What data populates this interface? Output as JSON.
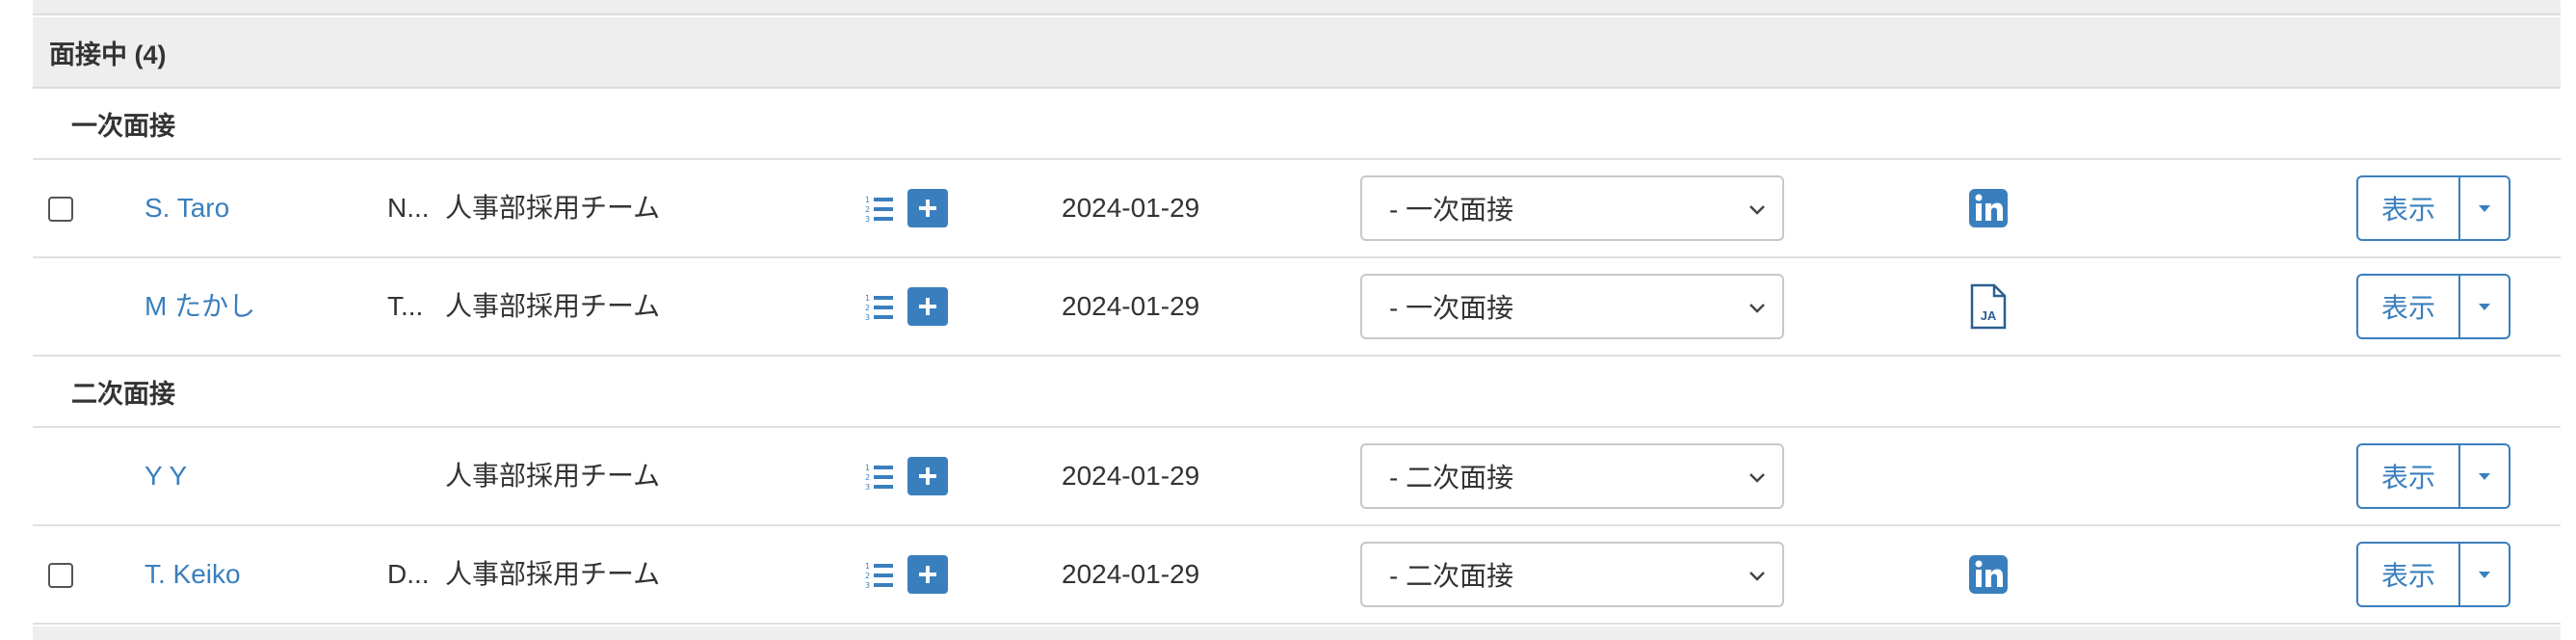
{
  "group": {
    "title": "面接中 (4)"
  },
  "stages": [
    {
      "label": "一次面接"
    },
    {
      "label": "二次面接"
    }
  ],
  "rows": [
    {
      "name": "S. Taro",
      "prefix": "N...",
      "team": "人事部採用チーム",
      "date": "2024-01-29",
      "stage": "- 一次面接",
      "doc_icon": "linkedin-icon",
      "view_label": "表示",
      "has_checkbox": true
    },
    {
      "name": "M たかし",
      "prefix": "T...",
      "team": "人事部採用チーム",
      "date": "2024-01-29",
      "stage": "- 一次面接",
      "doc_icon": "ja-document-icon",
      "doc_label": "JA",
      "view_label": "表示",
      "has_checkbox": false
    },
    {
      "name": "Y Y",
      "prefix": "",
      "team": "人事部採用チーム",
      "date": "2024-01-29",
      "stage": "- 二次面接",
      "doc_icon": "",
      "view_label": "表示",
      "has_checkbox": false
    },
    {
      "name": "T. Keiko",
      "prefix": "D...",
      "team": "人事部採用チーム",
      "date": "2024-01-29",
      "stage": "- 二次面接",
      "doc_icon": "linkedin-icon",
      "view_label": "表示",
      "has_checkbox": true
    }
  ],
  "colors": {
    "accent": "#3a7fbd",
    "header_bg": "#eeeeee",
    "border": "#e0e0e0"
  }
}
